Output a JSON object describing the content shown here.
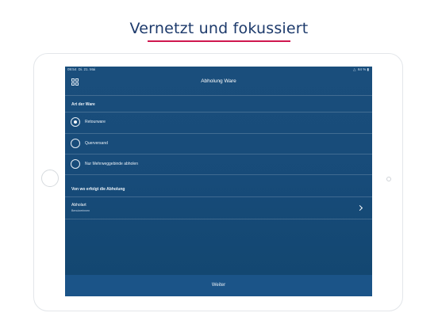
{
  "headline": "Vernetzt und fokussiert",
  "status": {
    "time": "09:54",
    "date": "Di. 21. Mai",
    "battery": "64 %"
  },
  "appbar": {
    "title": "Abholung Ware",
    "menu_icon": "grid-icon"
  },
  "sections": {
    "ware": {
      "header": "Art der Ware",
      "options": [
        {
          "label": "Retourware",
          "selected": true
        },
        {
          "label": "Querversand",
          "selected": false
        },
        {
          "label": "Nur Mehrweggebinde abholen",
          "selected": false
        }
      ]
    },
    "abholung": {
      "header": "Von wo erfolgt die Abholung",
      "item": {
        "title": "Abholart",
        "subtitle": "Benutzerinnen"
      }
    }
  },
  "footer": {
    "button_label": "Weiter"
  },
  "colors": {
    "accent": "#d0174f",
    "headline": "#1d3a6b",
    "screen": "#174b79",
    "footer": "#1b5488"
  }
}
